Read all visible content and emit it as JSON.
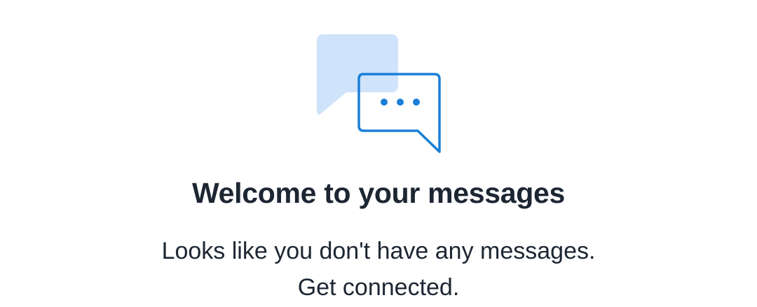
{
  "empty_state": {
    "illustration_icon": "chat-bubbles-icon",
    "title": "Welcome to your messages",
    "message_line_1": "Looks like you don't have any messages.",
    "message_line_2": "Get connected."
  },
  "colors": {
    "bubble_back": "#cfe3fb",
    "bubble_front_stroke": "#1a7fd8",
    "text": "#1d2633",
    "background": "#ffffff"
  }
}
